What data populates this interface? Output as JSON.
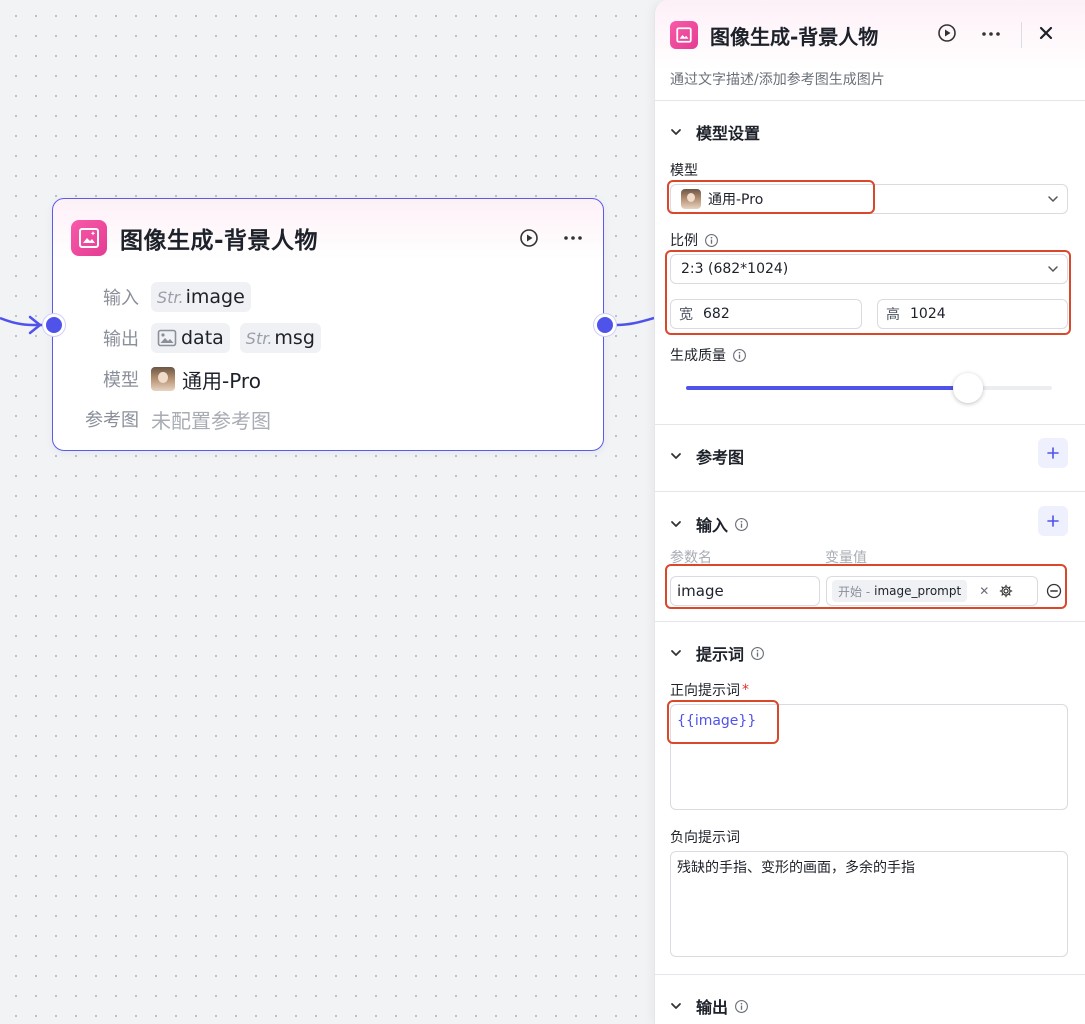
{
  "node": {
    "title": "图像生成-背景人物",
    "input_label": "输入",
    "output_label": "输出",
    "model_label": "模型",
    "ref_label": "参考图",
    "str_type": "Str.",
    "inputs": [
      "image"
    ],
    "outputs": [
      "data",
      "msg"
    ],
    "model": "通用-Pro",
    "ref_value": "未配置参考图"
  },
  "panel": {
    "title": "图像生成-背景人物",
    "description": "通过文字描述/添加参考图生成图片",
    "model_settings": {
      "title": "模型设置",
      "model_label": "模型",
      "model_value": "通用-Pro",
      "ratio_label": "比例",
      "ratio_value": "2:3 (682*1024)",
      "width_prefix": "宽",
      "width_value": "682",
      "height_prefix": "高",
      "height_value": "1024",
      "quality_label": "生成质量",
      "quality_value": 0.77
    },
    "reference": {
      "title": "参考图"
    },
    "inputs": {
      "title": "输入",
      "param_header": "参数名",
      "value_header": "变量值",
      "param_name": "image",
      "value_source": "开始 -",
      "value_var": "image_prompt"
    },
    "prompt": {
      "title": "提示词",
      "positive_label": "正向提示词",
      "required_mark": "*",
      "positive_value": "{{image}}",
      "negative_label": "负向提示词",
      "negative_value": "残缺的手指、变形的画面，多余的手指"
    },
    "output": {
      "title": "输出"
    }
  },
  "colors": {
    "accent": "#5053ea",
    "brand_pink": "#e43c93",
    "highlight": "#d9482b"
  }
}
